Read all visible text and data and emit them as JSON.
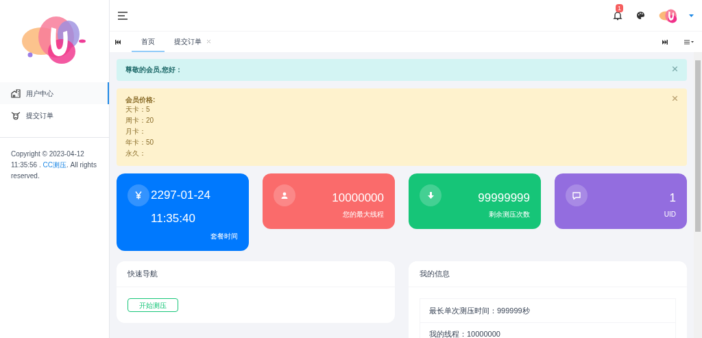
{
  "sidebar": {
    "items": [
      {
        "label": "用户中心",
        "selected": true
      },
      {
        "label": "提交订单",
        "selected": false
      }
    ],
    "copyright": {
      "before": "Copyright © 2023-04-12 11:35:56 . ",
      "link": "CC测压",
      "after": ". All rights reserved."
    }
  },
  "header": {
    "notification_count": "1"
  },
  "tabs": [
    {
      "label": "首页",
      "selected": true,
      "closable": false
    },
    {
      "label": "提交订单",
      "selected": false,
      "closable": true
    }
  ],
  "alerts": [
    {
      "kind": "info",
      "title": "尊敬的会员,您好："
    },
    {
      "kind": "warning",
      "title": "会员价格:",
      "lines": [
        "天卡：5",
        "周卡：20",
        "月卡：",
        "年卡：50",
        "永久："
      ]
    }
  ],
  "stats": [
    {
      "values": [
        "2297-01-24",
        "11:35:40"
      ],
      "label": "套餐时间",
      "color": "#0079fe"
    },
    {
      "values": [
        "10000000"
      ],
      "label": "您的最大线程",
      "color": "#fa6b6b"
    },
    {
      "values": [
        "99999999"
      ],
      "label": "剩余测压次数",
      "color": "#16c578"
    },
    {
      "values": [
        "1"
      ],
      "label": "UID",
      "color": "#936ddf"
    }
  ],
  "quick_nav": {
    "title": "快速导航",
    "buttons": [
      "开始测压"
    ]
  },
  "my_info": {
    "title": "我的信息",
    "rows": [
      "最长单次测压时间：999999秒",
      "我的线程：10000000"
    ]
  }
}
